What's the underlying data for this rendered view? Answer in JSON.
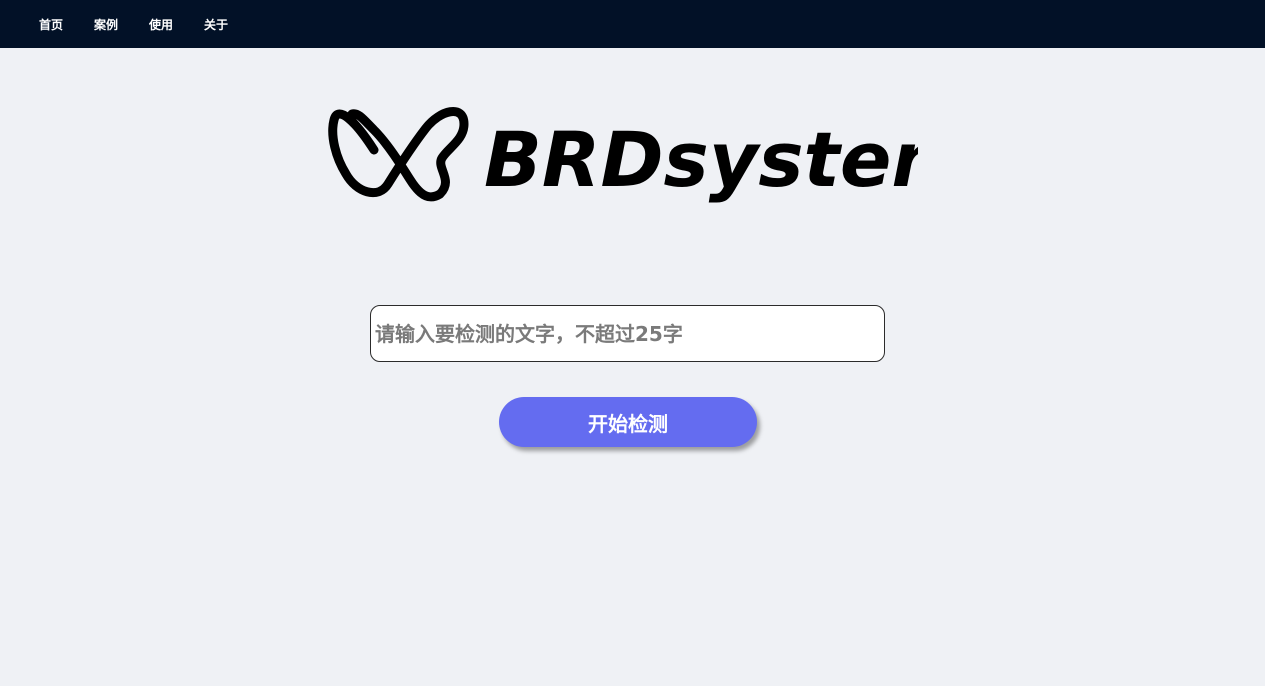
{
  "nav": {
    "items": [
      {
        "label": "首页"
      },
      {
        "label": "案例"
      },
      {
        "label": "使用"
      },
      {
        "label": "关于"
      }
    ]
  },
  "logo": {
    "text": "BRDsystem",
    "icon": "butterfly-icon"
  },
  "search": {
    "placeholder": "请输入要检测的文字，不超过25字",
    "value": ""
  },
  "actions": {
    "start_label": "开始检测"
  },
  "colors": {
    "topbar": "#021127",
    "background": "#eff1f5",
    "accent": "#646cf0"
  }
}
